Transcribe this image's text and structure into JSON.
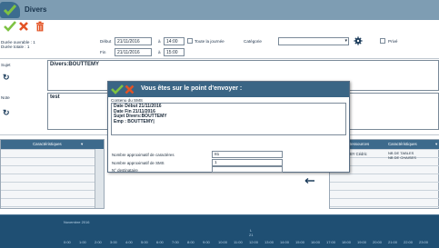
{
  "window": {
    "title": "Divers"
  },
  "toolbar": {
    "validate_icon": "check-icon",
    "cancel_icon": "close-icon",
    "delete_icon": "trash-icon"
  },
  "form": {
    "duree_ouvrable_label": "Durée ouvrable : 1",
    "duree_totale_label": "Durée totale : 1",
    "debut_label": "Début",
    "debut_date": "21/11/2016",
    "debut_a": "à",
    "debut_time": "14:00",
    "fin_label": "Fin",
    "fin_date": "21/11/2016",
    "fin_a": "à",
    "fin_time": "15:00",
    "toute_journee_label": "Toute la journée",
    "categorie_label": "Catégorie",
    "categorie_value": "",
    "prive_label": "Privé",
    "sujet_label": "Sujet",
    "sujet_value": "Divers:BOUTTEMY",
    "note_label": "Note",
    "note_value": "test"
  },
  "left_grid": {
    "header": "Caractéristiques"
  },
  "right_grid": {
    "header_ressources": "Ressources",
    "header_caracteristiques": "Caractéristiques",
    "row1_ressource": "BY Cédric",
    "row1_carac_1": "NB DE TABLES",
    "row1_carac_2": "NB DE CHAISES"
  },
  "dialog": {
    "title": "Vous êtes sur le point d'envoyer :",
    "contenu_label": "Contenu du SMS",
    "contenu_lines": [
      "Date Début 21/11/2016",
      "Date Fin 21/11/2016",
      "Sujet Divers:BOUTTEMY",
      "Emp : BOUTTEMY|"
    ],
    "nb_caracteres_label": "Nombre approximatif de caractères",
    "nb_caracteres_value": "81",
    "nb_sms_label": "Nombre approximatif de SMS",
    "nb_sms_value": "1",
    "destinataire_label": "N° destinataire",
    "destinataire_value": ""
  },
  "timeline": {
    "month_label": "Novembre 2016",
    "day_label_1": "L",
    "day_label_2": "21",
    "hours": [
      "0:00",
      "1:00",
      "2:00",
      "3:00",
      "4:00",
      "5:00",
      "6:00",
      "7:00",
      "8:00",
      "9:00",
      "10:00",
      "11:00",
      "12:00",
      "13:00",
      "14:00",
      "15:00",
      "16:00",
      "17:00",
      "18:00",
      "19:00",
      "20:00",
      "21:00",
      "22:00",
      "23:00"
    ]
  },
  "colors": {
    "header_blue": "#3a6585",
    "timeline_blue": "#1f4f73",
    "accent_green": "#7ec242",
    "accent_red": "#e35325"
  }
}
